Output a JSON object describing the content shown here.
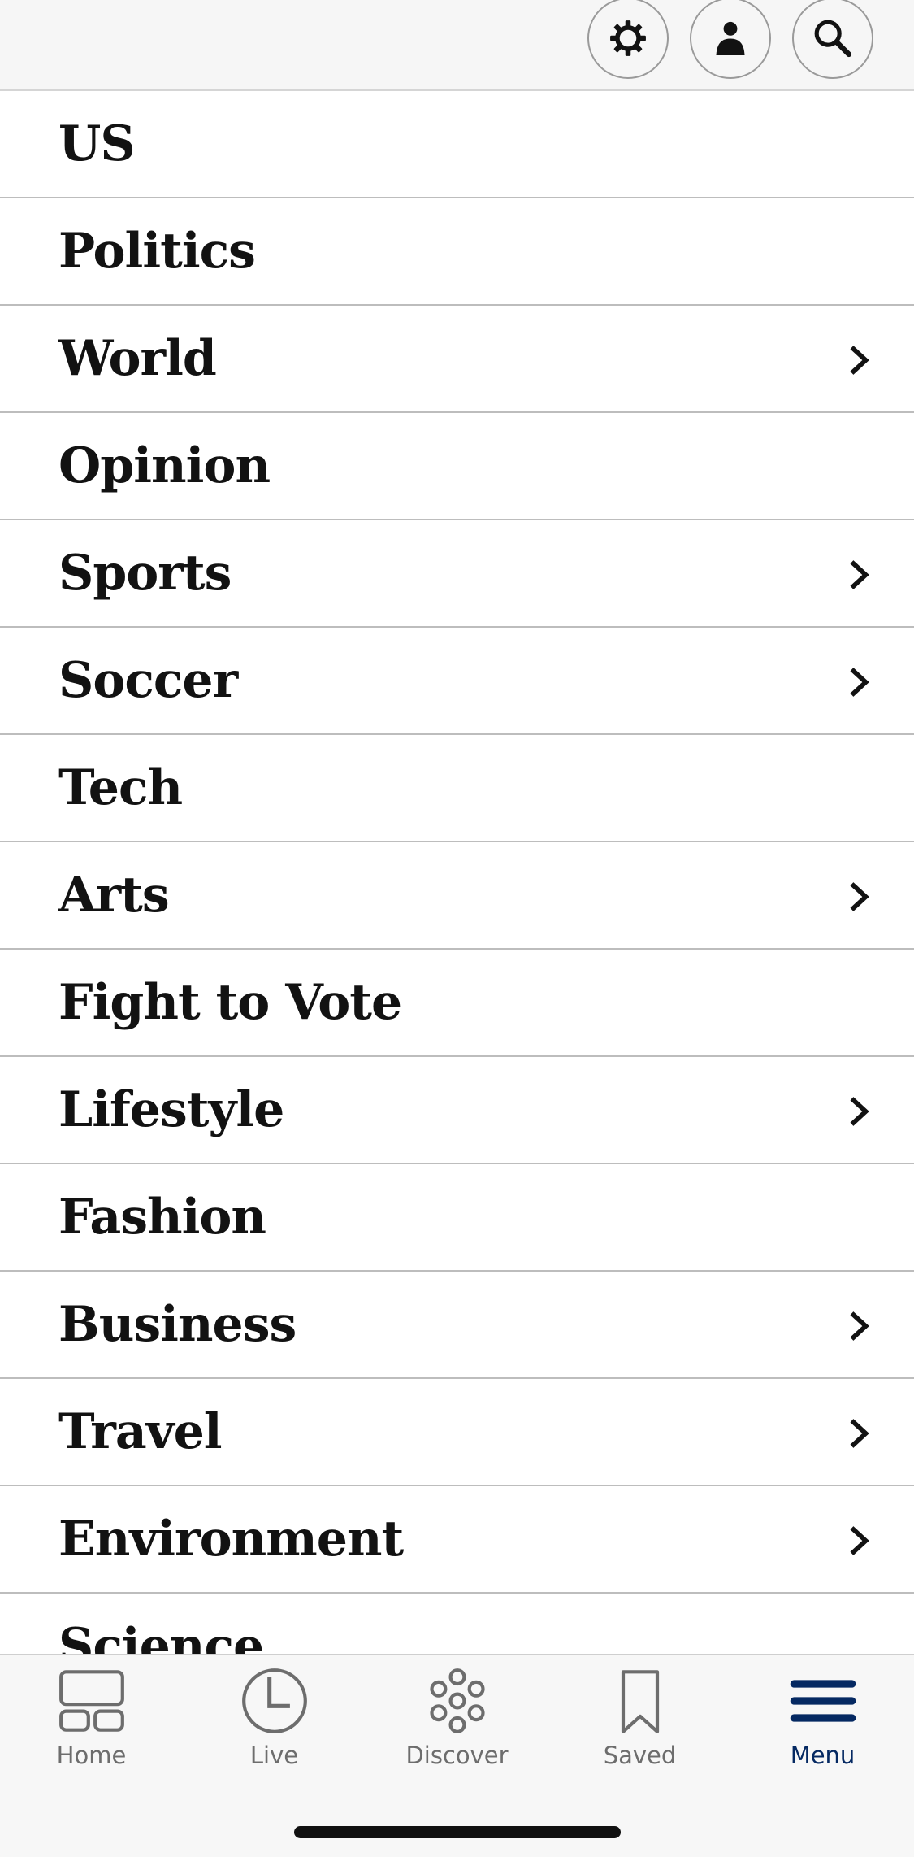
{
  "header": {
    "icons": [
      "settings-icon",
      "profile-icon",
      "search-icon"
    ]
  },
  "menu": {
    "items": [
      {
        "label": "US",
        "has_submenu": false
      },
      {
        "label": "Politics",
        "has_submenu": false
      },
      {
        "label": "World",
        "has_submenu": true
      },
      {
        "label": "Opinion",
        "has_submenu": false
      },
      {
        "label": "Sports",
        "has_submenu": true
      },
      {
        "label": "Soccer",
        "has_submenu": true
      },
      {
        "label": "Tech",
        "has_submenu": false
      },
      {
        "label": "Arts",
        "has_submenu": true
      },
      {
        "label": "Fight to Vote",
        "has_submenu": false
      },
      {
        "label": "Lifestyle",
        "has_submenu": true
      },
      {
        "label": "Fashion",
        "has_submenu": false
      },
      {
        "label": "Business",
        "has_submenu": true
      },
      {
        "label": "Travel",
        "has_submenu": true
      },
      {
        "label": "Environment",
        "has_submenu": true
      },
      {
        "label": "Science",
        "has_submenu": false
      }
    ]
  },
  "tabbar": {
    "tabs": [
      {
        "label": "Home",
        "icon": "home-icon"
      },
      {
        "label": "Live",
        "icon": "clock-icon"
      },
      {
        "label": "Discover",
        "icon": "discover-icon"
      },
      {
        "label": "Saved",
        "icon": "bookmark-icon"
      },
      {
        "label": "Menu",
        "icon": "menu-icon",
        "active": true
      }
    ]
  },
  "colors": {
    "active_tab": "#052962",
    "inactive_tab": "#6d6d6d",
    "text": "#121212"
  }
}
